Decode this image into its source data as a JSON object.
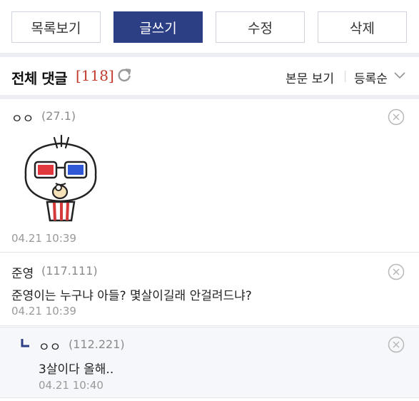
{
  "toolbar": {
    "list_label": "목록보기",
    "write_label": "글쓰기",
    "edit_label": "수정",
    "delete_label": "삭제",
    "accent": "#2c3e84"
  },
  "header": {
    "title": "전체 댓글",
    "count": "[118]",
    "view_label": "본문 보기",
    "sort_label": "등록순",
    "icons": [
      "refresh-icon",
      "chevron-down-icon"
    ]
  },
  "comments": [
    {
      "author": "ㅇㅇ",
      "ip": "(27.1)",
      "sticker": "3d-glasses-popcorn-sticker",
      "date": "04.21 10:39"
    },
    {
      "author": "준영",
      "ip": "(117.111)",
      "text": "준영이는 누구냐 아들? 몇살이길래 안걸려드냐?",
      "date": "04.21 10:39"
    },
    {
      "author": "ㅇㅇ",
      "ip": "(112.221)",
      "text": "3살이다 올해..",
      "date": "04.21 10:40",
      "is_reply": true
    }
  ]
}
